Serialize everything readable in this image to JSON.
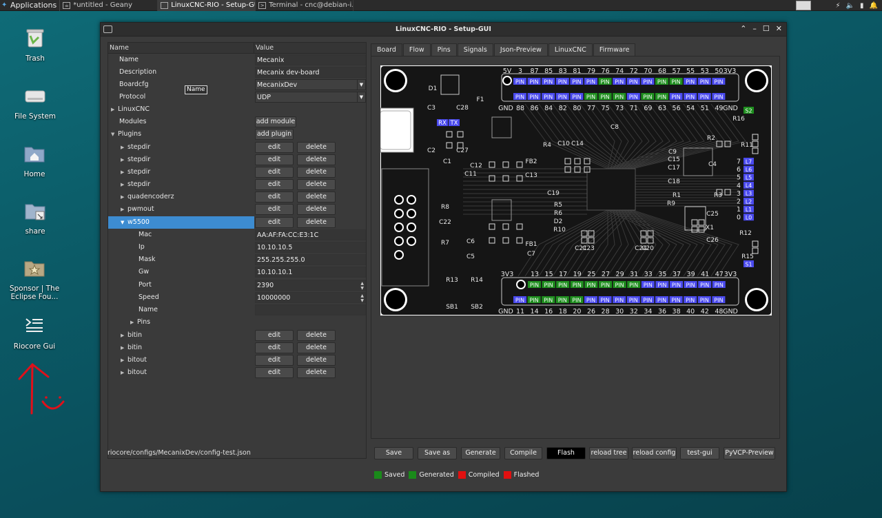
{
  "taskbar": {
    "apps_label": "Applications",
    "tasks": [
      {
        "label": "*untitled - Geany"
      },
      {
        "label": "LinuxCNC-RIO - Setup-GUI"
      },
      {
        "label": "Terminal - cnc@debian-i..."
      }
    ]
  },
  "desktop": {
    "icons": [
      {
        "label": "Trash"
      },
      {
        "label": "File System"
      },
      {
        "label": "Home"
      },
      {
        "label": "share"
      },
      {
        "label": "Sponsor | The Eclipse Fou..."
      },
      {
        "label": "Riocore Gui"
      }
    ]
  },
  "window": {
    "title": "LinuxCNC-RIO - Setup-GUI",
    "tree": {
      "col_name": "Name",
      "col_value": "Value",
      "tooltip": "Name",
      "rows": {
        "name": {
          "label": "Name",
          "value": "Mecanix"
        },
        "description": {
          "label": "Description",
          "value": "Mecanix dev-board"
        },
        "boardcfg": {
          "label": "Boardcfg",
          "value": "MecanixDev"
        },
        "protocol": {
          "label": "Protocol",
          "value": "UDP"
        },
        "linuxcnc": {
          "label": "LinuxCNC"
        },
        "modules": {
          "label": "Modules",
          "button": "add module"
        },
        "plugins": {
          "label": "Plugins",
          "button": "add plugin"
        },
        "mac": {
          "label": "Mac",
          "value": "AA:AF:FA:CC:E3:1C"
        },
        "ip": {
          "label": "Ip",
          "value": "10.10.10.5"
        },
        "mask": {
          "label": "Mask",
          "value": "255.255.255.0"
        },
        "gw": {
          "label": "Gw",
          "value": "10.10.10.1"
        },
        "port": {
          "label": "Port",
          "value": "2390"
        },
        "speed": {
          "label": "Speed",
          "value": "10000000"
        },
        "wname": {
          "label": "Name",
          "value": ""
        },
        "pins": {
          "label": "Pins"
        }
      },
      "plugins": [
        {
          "label": "stepdir"
        },
        {
          "label": "stepdir"
        },
        {
          "label": "stepdir"
        },
        {
          "label": "stepdir"
        },
        {
          "label": "quadencoderz"
        },
        {
          "label": "pwmout"
        },
        {
          "label": "w5500"
        }
      ],
      "plugins_after": [
        {
          "label": "bitin"
        },
        {
          "label": "bitin"
        },
        {
          "label": "bitout"
        },
        {
          "label": "bitout"
        }
      ],
      "edit_label": "edit",
      "delete_label": "delete"
    },
    "tabs": [
      {
        "label": "Board"
      },
      {
        "label": "Flow"
      },
      {
        "label": "Pins"
      },
      {
        "label": "Signals"
      },
      {
        "label": "Json-Preview"
      },
      {
        "label": "LinuxCNC"
      },
      {
        "label": "Firmware"
      }
    ],
    "board": {
      "top_header_left": "5V",
      "top_header_right": "3V3",
      "top_numbers": [
        "3",
        "87",
        "85",
        "83",
        "81",
        "79",
        "76",
        "74",
        "72",
        "70",
        "68",
        "57",
        "55",
        "53",
        "50"
      ],
      "top_bottom_left": "GND",
      "top_bottom_right": "GND",
      "top_bottom_numbers": [
        "88",
        "86",
        "84",
        "82",
        "80",
        "77",
        "75",
        "73",
        "71",
        "69",
        "63",
        "56",
        "54",
        "51",
        "49"
      ],
      "bot_header_left": "3V3",
      "bot_header_right": "3V3",
      "bot_numbers": [
        "13",
        "15",
        "17",
        "19",
        "25",
        "27",
        "29",
        "31",
        "33",
        "35",
        "37",
        "39",
        "41",
        "47"
      ],
      "bot_bottom_left": "GND",
      "bot_bottom_right": "GND",
      "bot_bottom_numbers": [
        "11",
        "14",
        "16",
        "18",
        "20",
        "26",
        "28",
        "30",
        "32",
        "34",
        "36",
        "38",
        "40",
        "42",
        "48"
      ],
      "pin_label": "PIN",
      "rx": "RX",
      "tx": "TX",
      "leds": [
        "L7",
        "L6",
        "L5",
        "L4",
        "L3",
        "L2",
        "L1",
        "L0"
      ],
      "led_nums": [
        "7",
        "6",
        "5",
        "4",
        "3",
        "2",
        "1",
        "0"
      ],
      "components": [
        "D1",
        "F1",
        "C3",
        "C28",
        "C2",
        "C27",
        "C1",
        "C8",
        "R16",
        "R11",
        "S2",
        "R2",
        "C9",
        "C15",
        "C17",
        "C18",
        "C4",
        "R1",
        "R3",
        "R9",
        "R4",
        "C10",
        "C14",
        "C11",
        "C12",
        "C13",
        "FB2",
        "C19",
        "R5",
        "R6",
        "D2",
        "R10",
        "R8",
        "C22",
        "C6",
        "R7",
        "C5",
        "C7",
        "FB1",
        "C21",
        "C23",
        "C24",
        "C20",
        "C25",
        "X1",
        "C26",
        "R12",
        "R15",
        "S1",
        "R13",
        "R14",
        "SB1",
        "SB2"
      ]
    },
    "config_path": "riocore/configs/MecanixDev/config-test.json",
    "buttons": {
      "save": "Save",
      "save_as": "Save as",
      "generate": "Generate",
      "compile": "Compile",
      "flash": "Flash",
      "reload_tree": "reload tree",
      "reload_config": "reload config",
      "test_gui": "test-gui",
      "pyvcp": "PyVCP-Preview"
    },
    "status": [
      {
        "label": "Saved",
        "color": "#1a8a1a"
      },
      {
        "label": "Generated",
        "color": "#1a8a1a"
      },
      {
        "label": "Compiled",
        "color": "#e01010"
      },
      {
        "label": "Flashed",
        "color": "#e01010"
      }
    ]
  }
}
